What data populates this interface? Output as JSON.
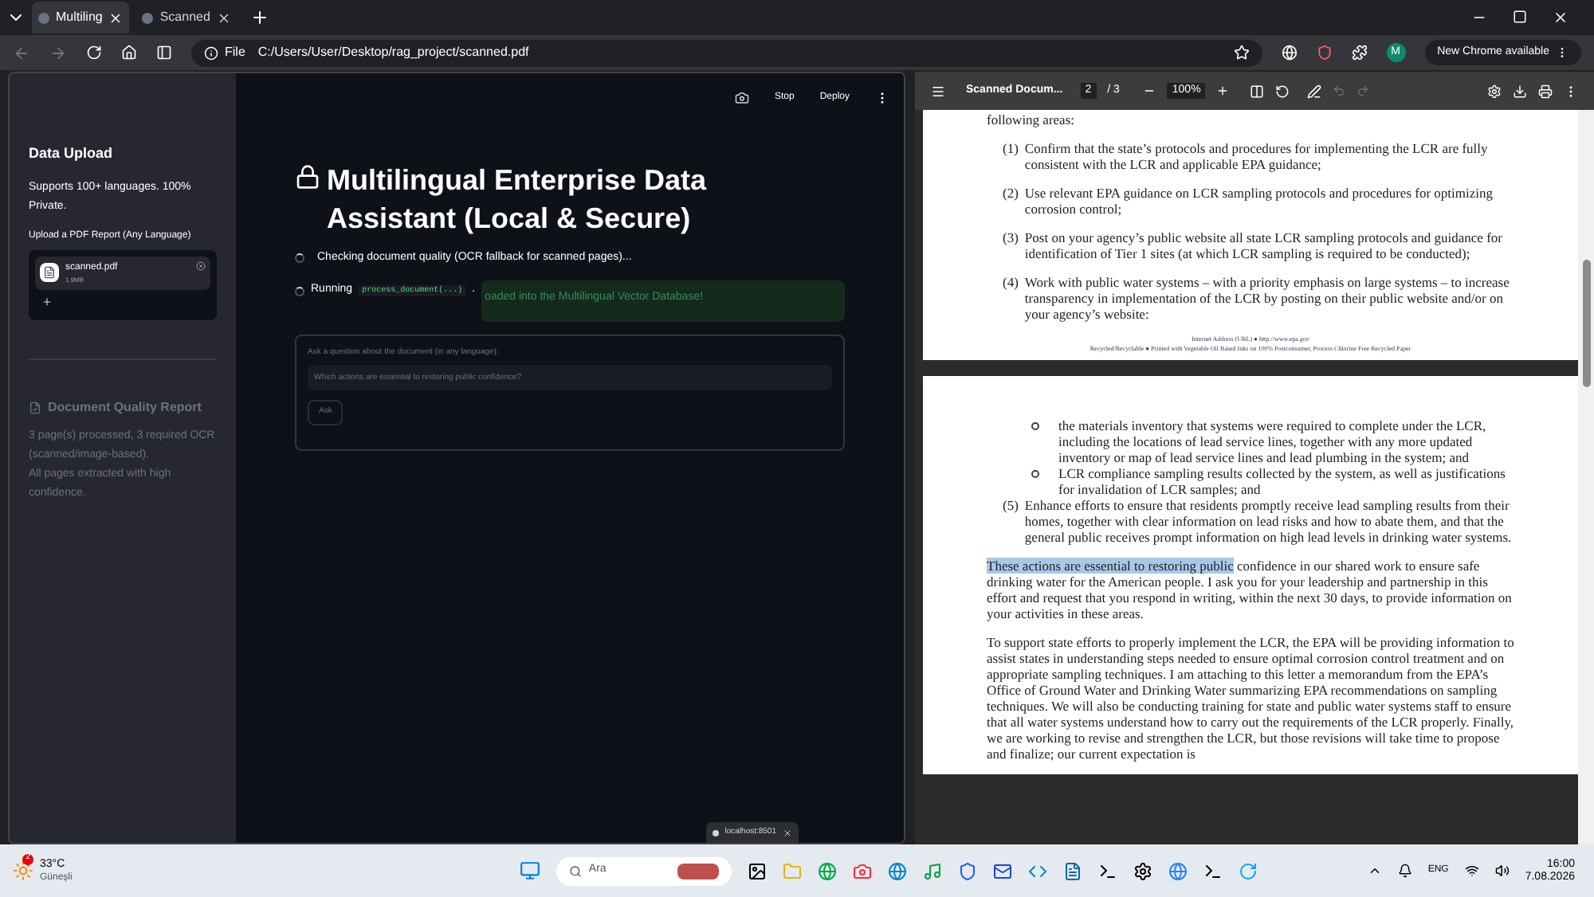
{
  "browser": {
    "tabs": [
      {
        "title": "Multiling",
        "selected": true
      },
      {
        "title": "Scanned",
        "selected": false
      }
    ],
    "address": {
      "scheme": "File",
      "url": "C:/Users/User/Desktop/rag_project/scanned.pdf"
    },
    "profile": "M",
    "update_button": "New Chrome available"
  },
  "app": {
    "toolbar": {
      "stop": "Stop",
      "deploy": "Deploy"
    },
    "sidebar": {
      "title": "Data Upload",
      "subtitle": "Supports 100+ languages. 100% Private.",
      "uploader_label": "Upload a PDF Report (Any Language)",
      "file": {
        "name": "scanned.pdf",
        "size": "1.9MB"
      },
      "report_title": "Document Quality Report",
      "report_lines": [
        "3 page(s) processed, 3 required OCR (scanned/image-based).",
        "All pages extracted with high confidence."
      ]
    },
    "main": {
      "title": "Multilingual Enterprise Data Assistant (Local & Secure)",
      "status": "Checking document quality (OCR fallback for scanned pages)...",
      "running_label": "Running",
      "running_code": "process_document(...)",
      "running_suffix": ".",
      "success": "oaded into the Multilingual Vector Database!",
      "question_label": "Ask a question about the document (in any language):",
      "question_value": "Which actions are essential to restoring public confidence?",
      "ask_button": "Ask"
    },
    "popup_tab": "localhost:8501"
  },
  "pdf_viewer": {
    "title": "Scanned Docum...",
    "page": "2",
    "page_total": "/ 3",
    "zoom": "100%",
    "pages": [
      {
        "blocks": [
          {
            "kind": "para",
            "text": "following areas:"
          },
          {
            "kind": "item",
            "label": "(1)",
            "text": "Confirm that the state’s protocols and procedures for implementing the LCR are fully consistent with the LCR and applicable EPA guidance;"
          },
          {
            "kind": "item",
            "label": "(2)",
            "text": "Use relevant EPA guidance on LCR sampling protocols and procedures for optimizing corrosion control;"
          },
          {
            "kind": "item",
            "label": "(3)",
            "text": "Post on your agency’s public website all state LCR sampling protocols and guidance for identification of Tier 1 sites (at which LCR sampling is required to be conducted);"
          },
          {
            "kind": "item",
            "label": "(4)",
            "text": "Work with public water systems – with a priority emphasis on large systems – to increase transparency in implementation of the LCR by posting on their public website and/or on your agency’s website:"
          },
          {
            "kind": "footer",
            "text": "Internet Address (URL) ● http://www.epa.gov"
          },
          {
            "kind": "footer",
            "text": "Recycled/Recyclable ● Printed with Vegetable Oil Based Inks on 100% Postconsumer, Process Chlorine Free Recycled Paper"
          }
        ]
      },
      {
        "blocks": [
          {
            "kind": "bullet",
            "text": "the materials inventory that systems were required to complete under the LCR, including the locations of lead service lines, together with any more updated inventory or map of lead service lines and lead plumbing in the system; and"
          },
          {
            "kind": "bullet",
            "text": "LCR compliance sampling results collected by the system, as well as justifications for invalidation of LCR samples; and"
          },
          {
            "kind": "item",
            "label": "(5)",
            "text": "Enhance efforts to ensure that residents promptly receive lead sampling results from their homes, together with clear information on lead risks and how to abate them, and that the general public receives prompt information on high lead levels in drinking water systems."
          },
          {
            "kind": "para",
            "highlight": "These actions are essential to restoring public",
            "text": " confidence in our shared work to ensure safe drinking water for the American people. I ask you for your leadership and partnership in this effort and request that you respond in writing, within the next 30 days, to provide information on your activities in these areas."
          },
          {
            "kind": "para",
            "text": "To support state efforts to properly implement the LCR, the EPA will be providing information to assist states in understanding steps needed to ensure optimal corrosion control treatment and on appropriate sampling techniques. I am attaching to this letter a memorandum from the EPA’s Office of Ground Water and Drinking Water summarizing EPA recommendations on sampling techniques. We will also be conducting training for state and public water systems staff to ensure that all water systems understand how to carry out the requirements of the LCR properly. Finally, we are working to revise and strengthen the LCR, but those revisions will take time to propose and finalize; our current expectation is"
          }
        ]
      }
    ]
  },
  "taskbar": {
    "weather": {
      "badge": "2",
      "temp": "33°C",
      "condition": "Güneşli"
    },
    "search_placeholder": "Ara",
    "language": "ENG",
    "time": "16:00",
    "date": "7.08.2026"
  }
}
